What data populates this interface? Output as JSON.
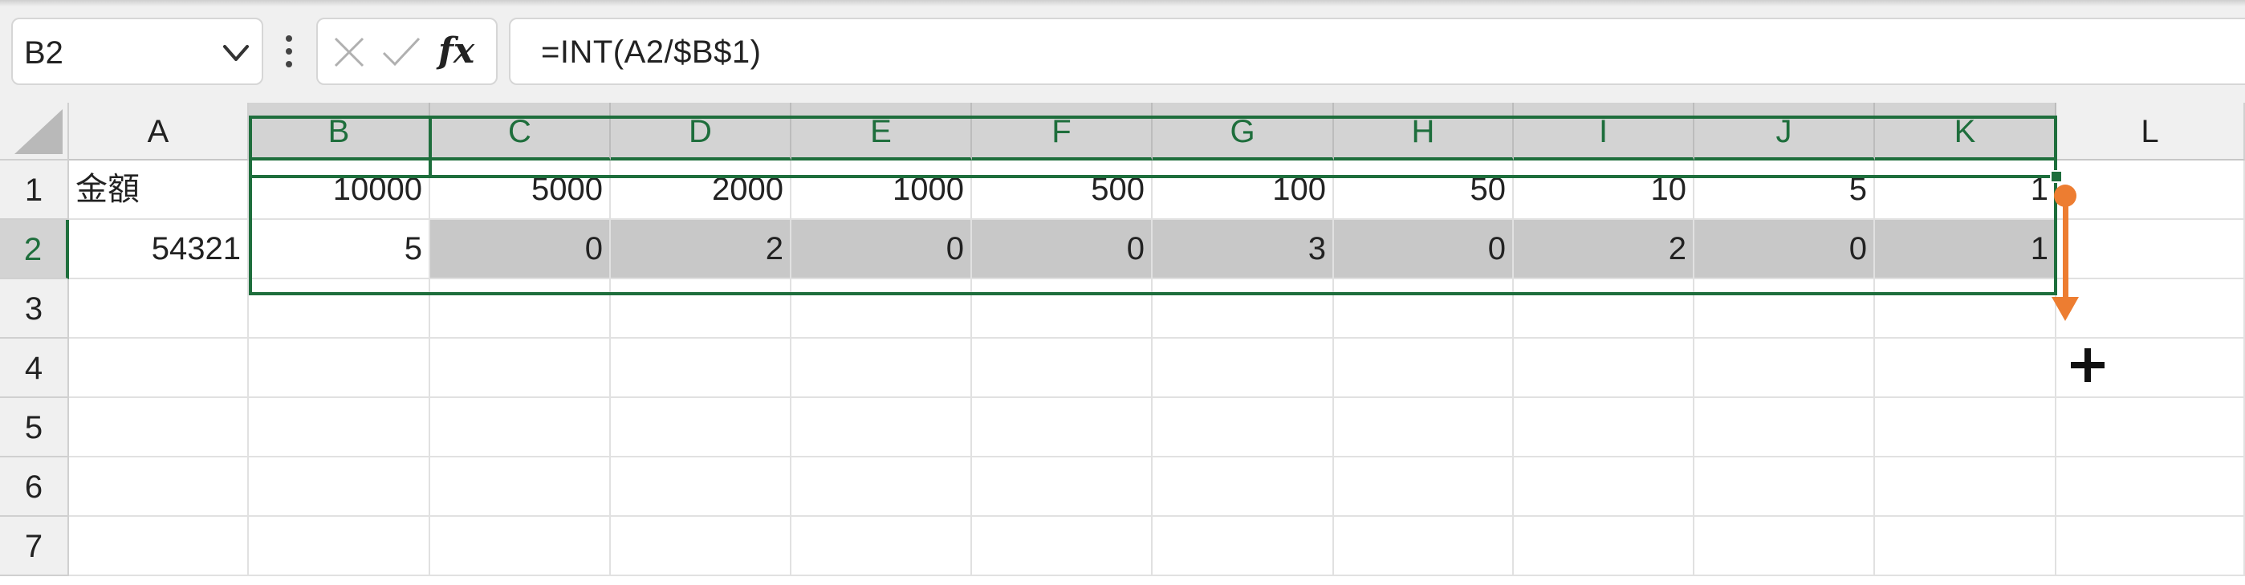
{
  "formula_bar": {
    "name_box": "B2",
    "formula": "=INT(A2/$B$1)",
    "fx_label": "fx"
  },
  "columns": [
    "A",
    "B",
    "C",
    "D",
    "E",
    "F",
    "G",
    "H",
    "I",
    "J",
    "K",
    "L"
  ],
  "rows": [
    "1",
    "2",
    "3",
    "4",
    "5",
    "6",
    "7"
  ],
  "cells": {
    "A1": "金額",
    "B1": "10000",
    "C1": "5000",
    "D1": "2000",
    "E1": "1000",
    "F1": "500",
    "G1": "100",
    "H1": "50",
    "I1": "10",
    "J1": "5",
    "K1": "1",
    "A2": "54321",
    "B2": "5",
    "C2": "0",
    "D2": "2",
    "E2": "0",
    "F2": "0",
    "G2": "3",
    "H2": "0",
    "I2": "2",
    "J2": "0",
    "K2": "1"
  },
  "colors": {
    "selection": "#1e6e3c",
    "arrow": "#ed7d31",
    "highlight": "#c8c8c8"
  },
  "icons": [
    "chevron-down-icon",
    "more-vertical-icon",
    "cancel-icon",
    "enter-icon",
    "fx-icon",
    "plus-cursor-icon",
    "drag-arrow-icon"
  ]
}
